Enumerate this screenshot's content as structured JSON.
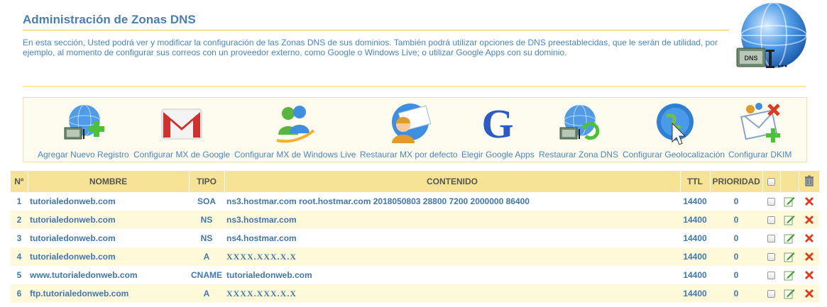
{
  "header": {
    "title": "Administración de Zonas DNS",
    "description": "En esta sección, Usted podrá ver y modificar la configuración de las Zonas DNS de sus dominios. También podrá utilizar opciones de DNS preestablecidas, que le serán de utilidad, por ejemplo, al momento de configurar sus correos con un proveedor externo, como Google o Windows Live; o utilizar Google Apps con su dominio.",
    "icon": "dns-globe-icon",
    "icon_text": "DNS"
  },
  "toolbar": {
    "items": [
      {
        "label": "Agregar Nuevo Registro",
        "icon": "globe-dns-add-icon"
      },
      {
        "label": "Configurar MX de Google",
        "icon": "gmail-icon"
      },
      {
        "label": "Configurar MX de Windows Live",
        "icon": "windows-live-messenger-icon"
      },
      {
        "label": "Restaurar MX por defecto",
        "icon": "mail-user-icon"
      },
      {
        "label": "Elegir Google Apps",
        "icon": "google-g-icon"
      },
      {
        "label": "Restaurar Zona DNS",
        "icon": "globe-dns-restore-icon"
      },
      {
        "label": "Configurar Geolocalización",
        "icon": "globe-cursor-icon"
      },
      {
        "label": "Configurar DKIM",
        "icon": "envelope-key-icon"
      }
    ]
  },
  "table": {
    "columns": [
      "Nº",
      "NOMBRE",
      "TIPO",
      "CONTENIDO",
      "TTL",
      "PRIORIDAD"
    ],
    "rows": [
      {
        "num": "1",
        "nombre": "tutorialedonweb.com",
        "tipo": "SOA",
        "contenido": "ns3.hostmar.com root.hostmar.com 2018050803 28800 7200 2000000 86400",
        "ttl": "14400",
        "prioridad": "0"
      },
      {
        "num": "2",
        "nombre": "tutorialedonweb.com",
        "tipo": "NS",
        "contenido": "ns3.hostmar.com",
        "ttl": "14400",
        "prioridad": "0"
      },
      {
        "num": "3",
        "nombre": "tutorialedonweb.com",
        "tipo": "NS",
        "contenido": "ns4.hostmar.com",
        "ttl": "14400",
        "prioridad": "0"
      },
      {
        "num": "4",
        "nombre": "tutorialedonweb.com",
        "tipo": "A",
        "contenido": "XXXX.XXX.X.X",
        "ttl": "14400",
        "prioridad": "0"
      },
      {
        "num": "5",
        "nombre": "www.tutorialedonweb.com",
        "tipo": "CNAME",
        "contenido": "tutorialedonweb.com",
        "ttl": "14400",
        "prioridad": "0"
      },
      {
        "num": "6",
        "nombre": "ftp.tutorialedonweb.com",
        "tipo": "A",
        "contenido": "XXXX.XXX.X.X",
        "ttl": "14400",
        "prioridad": "0"
      }
    ]
  },
  "colors": {
    "title": "#4a7fb5",
    "link": "#4a86c5",
    "header_bg": "#f7e396",
    "row_alt": "#fdf9d9",
    "delete_red": "#e03a1e",
    "edit_green": "#3c9a2a"
  }
}
